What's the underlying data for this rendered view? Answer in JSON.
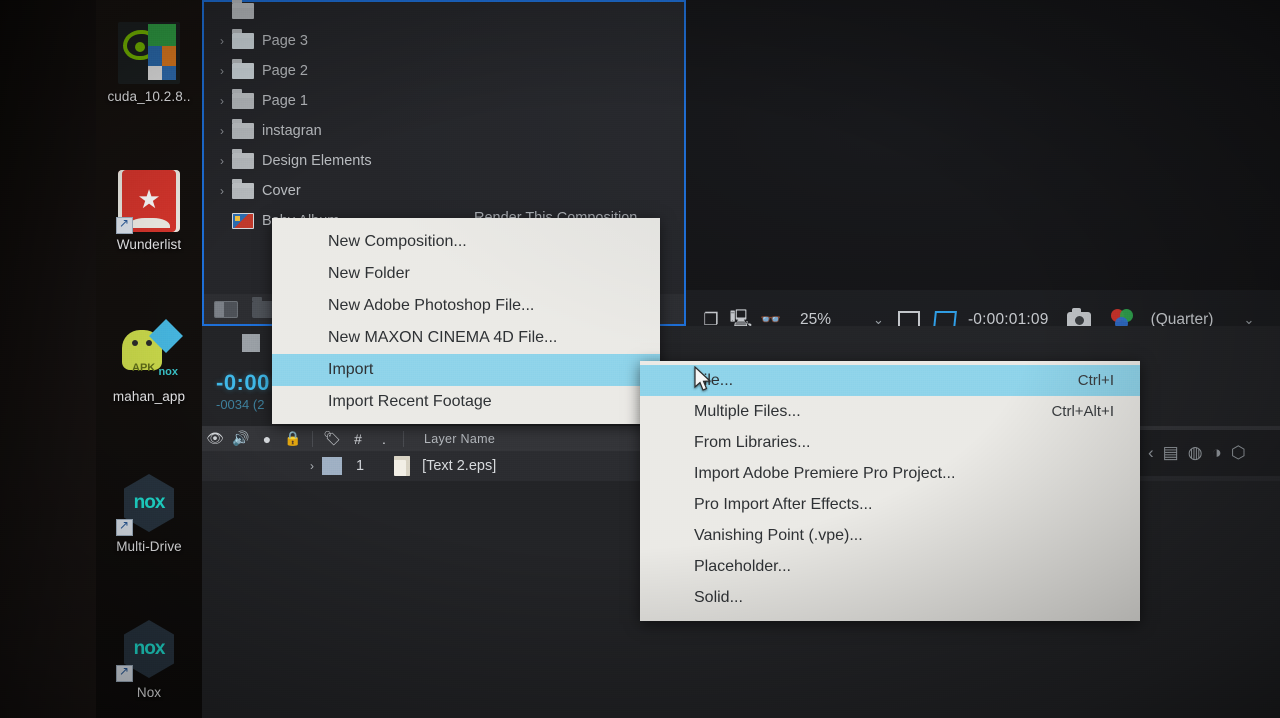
{
  "desktop": {
    "icons": [
      {
        "name": "cuda_10.2.8..",
        "icon": "nvidia-cuda-installer-icon"
      },
      {
        "name": "Wunderlist",
        "icon": "wunderlist-icon"
      },
      {
        "name": "mahan_app",
        "icon": "android-apk-nox-icon"
      },
      {
        "name": "Multi-Drive",
        "icon": "nox-multi-drive-icon"
      },
      {
        "name": "Nox",
        "icon": "nox-player-icon"
      }
    ]
  },
  "project_panel": {
    "items": [
      {
        "label": "Page 3",
        "type": "folder"
      },
      {
        "label": "Page 2",
        "type": "folder"
      },
      {
        "label": "Page 1",
        "type": "folder"
      },
      {
        "label": "instagran",
        "type": "folder"
      },
      {
        "label": "Design Elements",
        "type": "folder"
      },
      {
        "label": "Cover",
        "type": "folder"
      },
      {
        "label": "Baby Album",
        "type": "composition"
      }
    ],
    "render_link": "Render This Composition",
    "twirl": "›",
    "footer": {
      "new_composition": "new-composition-icon",
      "new_folder": "new-folder-icon"
    }
  },
  "viewer_toolbar": {
    "zoom": "25%",
    "dropdown_chevron": "⌄",
    "timecode": "-0:00:01:09",
    "resolution": "(Quarter)",
    "resolution_chevron": "⌄",
    "icons": {
      "take_snapshot": "snapshot-icon",
      "show_snapshot": "show-snapshot-icon",
      "show_channel": "show-channel-icon",
      "toggle_mask": "toggle-mask-icon",
      "region_of_interest": "region-of-interest-icon",
      "camera": "camera-icon",
      "color_management": "color-management-icon"
    }
  },
  "timeline": {
    "timecode": "-0:00:",
    "sub": "-0034 (2",
    "header": {
      "video": "eye-icon",
      "audio": "speaker-icon",
      "solo": "solo-icon",
      "lock": "lock-icon",
      "label": "label-tag-icon",
      "number": "#",
      "dot": ".",
      "layer_name": "Layer Name"
    },
    "rows": [
      {
        "twirl": "›",
        "number": "1",
        "name": "[Text 2.eps]"
      }
    ]
  },
  "right_strip": {
    "icons": [
      "chevron-left-icon",
      "info-panel-icon",
      "audio-panel-icon",
      "preview-panel-icon",
      "effects-panel-icon"
    ]
  },
  "context_menu": {
    "items": [
      {
        "label": "New Composition...",
        "highlighted": false,
        "submenu": false
      },
      {
        "label": "New Folder",
        "highlighted": false,
        "submenu": false
      },
      {
        "label": "New Adobe Photoshop File...",
        "highlighted": false,
        "submenu": false
      },
      {
        "label": "New MAXON CINEMA 4D File...",
        "highlighted": false,
        "submenu": false
      },
      {
        "label": "Import",
        "highlighted": true,
        "submenu": true
      },
      {
        "label": "Import Recent Footage",
        "highlighted": false,
        "submenu": true
      }
    ],
    "submenu_arrow": "›"
  },
  "submenu": {
    "items": [
      {
        "label": "File...",
        "shortcut": "Ctrl+I",
        "highlighted": true
      },
      {
        "label": "Multiple Files...",
        "shortcut": "Ctrl+Alt+I",
        "highlighted": false
      },
      {
        "label": "From Libraries...",
        "shortcut": "",
        "highlighted": false
      },
      {
        "label": "Import Adobe Premiere Pro Project...",
        "shortcut": "",
        "highlighted": false
      },
      {
        "label": "Pro Import After Effects...",
        "shortcut": "",
        "highlighted": false
      },
      {
        "label": "Vanishing Point (.vpe)...",
        "shortcut": "",
        "highlighted": false
      },
      {
        "label": "Placeholder...",
        "shortcut": "",
        "highlighted": false
      },
      {
        "label": "Solid...",
        "shortcut": "",
        "highlighted": false
      }
    ]
  },
  "cursor": {
    "name": "mouse-pointer"
  },
  "colors": {
    "menu_highlight": "#8fd4ea",
    "menu_background": "#ebeae6",
    "panel_border_active": "#1d6fd8",
    "timecode_accent": "#3fb8e8"
  }
}
